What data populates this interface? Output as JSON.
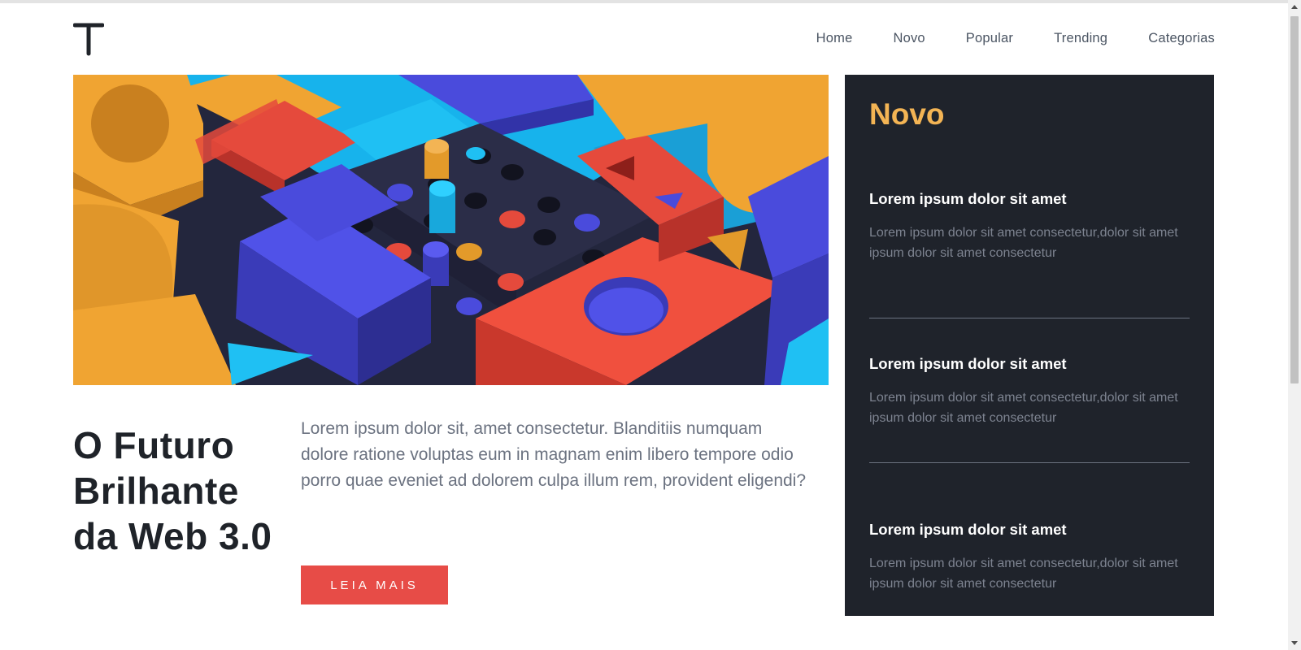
{
  "logo": {
    "letter": "T"
  },
  "nav": {
    "items": [
      {
        "label": "Home"
      },
      {
        "label": "Novo"
      },
      {
        "label": "Popular"
      },
      {
        "label": "Trending"
      },
      {
        "label": "Categorias"
      }
    ]
  },
  "hero": {
    "image_description_icon": "abstract-3d-blocks-image",
    "title": "O Futuro Brilhante da Web 3.0",
    "text": "Lorem ipsum dolor sit, amet consectetur. Blanditiis numquam dolore ratione voluptas eum in magnam enim libero tempore odio porro quae eveniet ad dolorem culpa illum rem, provident eligendi?",
    "cta_label": "LEIA MAIS"
  },
  "sidebar": {
    "title": "Novo",
    "items": [
      {
        "title": "Lorem ipsum dolor sit amet",
        "text": "Lorem ipsum dolor sit amet consectetur,dolor sit amet ipsum dolor sit amet consectetur"
      },
      {
        "title": "Lorem ipsum dolor sit amet",
        "text": "Lorem ipsum dolor sit amet consectetur,dolor sit amet ipsum dolor sit amet consectetur"
      },
      {
        "title": "Lorem ipsum dolor sit amet",
        "text": "Lorem ipsum dolor sit amet consectetur,dolor sit amet ipsum dolor sit amet consectetur"
      }
    ]
  },
  "colors": {
    "accent": "#f3b454",
    "cta": "#e74c47",
    "sidebar_bg": "#1f232b",
    "headline": "#1f2329"
  }
}
